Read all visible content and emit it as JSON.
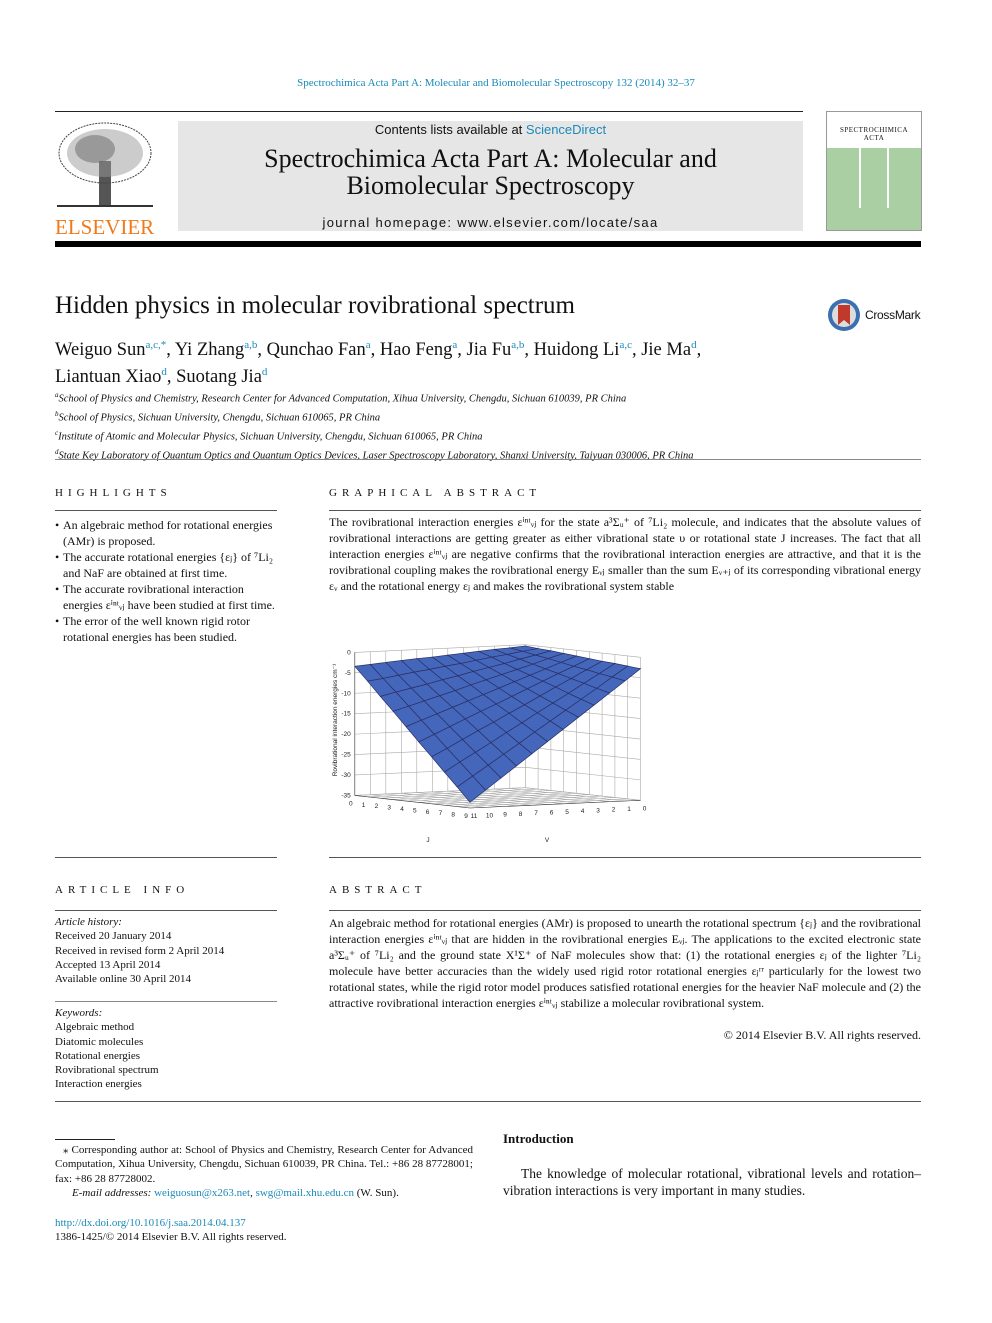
{
  "journal_ref": "Spectrochimica Acta Part A: Molecular and Biomolecular Spectroscopy 132 (2014) 32–37",
  "header": {
    "contents_prefix": "Contents lists available at ",
    "sciencedirect": "ScienceDirect",
    "journal_title_1": "Spectrochimica Acta Part A: Molecular and",
    "journal_title_2": "Biomolecular Spectroscopy",
    "homepage": "journal homepage: www.elsevier.com/locate/saa",
    "publisher_logo": "ELSEVIER",
    "cover_title_1": "SPECTROCHIMICA",
    "cover_title_2": "ACTA"
  },
  "article": {
    "title": "Hidden physics in molecular rovibrational spectrum",
    "crossmark": "CrossMark",
    "authors": [
      {
        "name": "Weiguo Sun",
        "aff": "a,c,*"
      },
      {
        "name": "Yi Zhang",
        "aff": "a,b"
      },
      {
        "name": "Qunchao Fan",
        "aff": "a"
      },
      {
        "name": "Hao Feng",
        "aff": "a"
      },
      {
        "name": "Jia Fu",
        "aff": "a,b"
      },
      {
        "name": "Huidong Li",
        "aff": "a,c"
      },
      {
        "name": "Jie Ma",
        "aff": "d"
      },
      {
        "name": "Liantuan Xiao",
        "aff": "d"
      },
      {
        "name": "Suotang Jia",
        "aff": "d"
      }
    ],
    "affiliations": [
      {
        "key": "a",
        "text": "School of Physics and Chemistry, Research Center for Advanced Computation, Xihua University, Chengdu, Sichuan 610039, PR China"
      },
      {
        "key": "b",
        "text": "School of Physics, Sichuan University, Chengdu, Sichuan 610065, PR China"
      },
      {
        "key": "c",
        "text": "Institute of Atomic and Molecular Physics, Sichuan University, Chengdu, Sichuan 610065, PR China"
      },
      {
        "key": "d",
        "text": "State Key Laboratory of Quantum Optics and Quantum Optics Devices, Laser Spectroscopy Laboratory, Shanxi University, Taiyuan 030006, PR China"
      }
    ]
  },
  "highlights": {
    "heading": "HIGHLIGHTS",
    "items": [
      "An algebraic method for rotational energies (AMr) is proposed.",
      "The accurate rotational energies {εⱼ} of ⁷Li₂ and NaF are obtained at first time.",
      "The accurate rovibrational interaction energies εⁱⁿᵗᵥⱼ have been studied at first time.",
      "The error of the well known rigid rotor rotational energies has been studied."
    ]
  },
  "graphical_abstract": {
    "heading": "GRAPHICAL ABSTRACT",
    "text": "The rovibrational interaction energies εⁱⁿᵗᵥⱼ for the state a³Σᵤ⁺ of ⁷Li₂ molecule, and indicates that the absolute values of rovibrational interactions are getting greater as either vibrational state υ or rotational state J increases. The fact that all interaction energies εⁱⁿᵗᵥⱼ are negative confirms that the rovibrational interaction energies are attractive, and that it is the rovibrational coupling makes the rovibrational energy Eᵥⱼ smaller than the sum Eᵥ₊ⱼ of its corresponding vibrational energy εᵥ and the rotational energy εⱼ and makes the rovibrational system stable"
  },
  "chart_data": {
    "type": "surface",
    "xlabel": "J",
    "ylabel": "V",
    "zlabel": "Rovibrational interaction energies cm⁻¹",
    "x_ticks": [
      0,
      1,
      2,
      3,
      4,
      5,
      6,
      7,
      8,
      9
    ],
    "y_ticks": [
      0,
      1,
      2,
      3,
      4,
      5,
      6,
      7,
      8,
      9,
      10,
      11
    ],
    "z_ticks": [
      0,
      -5,
      -10,
      -15,
      -20,
      -25,
      -30,
      -35
    ],
    "zlim": [
      -35,
      0
    ],
    "grid": true,
    "color": "#4466bb",
    "z_values_by_J_then_V": [
      [
        -0.3,
        -0.6,
        -0.8,
        -1.1,
        -1.4,
        -1.7,
        -2.0,
        -2.2,
        -2.5,
        -2.8,
        -3.1,
        -3.4
      ],
      [
        -0.6,
        -1.1,
        -1.7,
        -2.2,
        -2.8,
        -3.4,
        -3.9,
        -4.5,
        -5.0,
        -5.6,
        -6.2,
        -6.7
      ],
      [
        -0.8,
        -1.7,
        -2.5,
        -3.4,
        -4.2,
        -5.0,
        -5.9,
        -6.7,
        -7.6,
        -8.4,
        -9.2,
        -10.1
      ],
      [
        -1.1,
        -2.2,
        -3.4,
        -4.5,
        -5.6,
        -6.7,
        -7.8,
        -9.0,
        -10.1,
        -11.2,
        -12.3,
        -13.4
      ],
      [
        -1.4,
        -2.8,
        -4.2,
        -5.6,
        -7.0,
        -8.4,
        -9.8,
        -11.2,
        -12.6,
        -14.0,
        -15.4,
        -16.8
      ],
      [
        -1.7,
        -3.4,
        -5.0,
        -6.7,
        -8.4,
        -10.1,
        -11.8,
        -13.4,
        -15.1,
        -16.8,
        -18.5,
        -20.2
      ],
      [
        -2.0,
        -3.9,
        -5.9,
        -7.8,
        -9.8,
        -11.8,
        -13.7,
        -15.7,
        -17.6,
        -19.6,
        -21.6,
        -23.5
      ],
      [
        -2.2,
        -4.5,
        -6.7,
        -9.0,
        -11.2,
        -13.4,
        -15.7,
        -17.9,
        -20.2,
        -22.4,
        -24.6,
        -26.9
      ],
      [
        -2.5,
        -5.0,
        -7.6,
        -10.1,
        -12.6,
        -15.1,
        -17.6,
        -20.2,
        -22.7,
        -25.2,
        -27.7,
        -30.2
      ],
      [
        -2.8,
        -5.6,
        -8.4,
        -11.2,
        -14.0,
        -16.8,
        -19.6,
        -22.4,
        -25.2,
        -28.0,
        -30.8,
        -33.6
      ]
    ]
  },
  "article_info": {
    "heading": "ARTICLE INFO",
    "history_label": "Article history:",
    "history": [
      "Received 20 January 2014",
      "Received in revised form 2 April 2014",
      "Accepted 13 April 2014",
      "Available online 30 April 2014"
    ],
    "keywords_label": "Keywords:",
    "keywords": [
      "Algebraic method",
      "Diatomic molecules",
      "Rotational energies",
      "Rovibrational spectrum",
      "Interaction energies"
    ]
  },
  "abstract": {
    "heading": "ABSTRACT",
    "text": "An algebraic method for rotational energies (AMr) is proposed to unearth the rotational spectrum {εⱼ} and the rovibrational interaction energies εⁱⁿᵗᵥⱼ that are hidden in the rovibrational energies Eᵥⱼ. The applications to the excited electronic state a³Σᵤ⁺ of ⁷Li₂ and the ground state X¹Σ⁺ of NaF molecules show that: (1) the rotational energies εⱼ of the lighter ⁷Li₂ molecule have better accuracies than the widely used rigid rotor rotational energies εⱼʳʳ particularly for the lowest two rotational states, while the rigid rotor model produces satisfied rotational energies for the heavier NaF molecule and (2) the attractive rovibrational interaction energies εⁱⁿᵗᵥⱼ stabilize a molecular rovibrational system.",
    "copyright": "© 2014 Elsevier B.V. All rights reserved."
  },
  "footnote": {
    "corresponding": "⁎ Corresponding author at: School of Physics and Chemistry, Research Center for Advanced Computation, Xihua University, Chengdu, Sichuan 610039, PR China. Tel.: +86 28 87728001; fax: +86 28 87728002.",
    "email_label": "E-mail addresses:",
    "email1": "weiguosun@x263.net",
    "email2": "swg@mail.xhu.edu.cn",
    "email_suffix": " (W. Sun).",
    "doi": "http://dx.doi.org/10.1016/j.saa.2014.04.137",
    "issn": "1386-1425/© 2014 Elsevier B.V. All rights reserved."
  },
  "introduction": {
    "heading": "Introduction",
    "text": "The knowledge of molecular rotational, vibrational levels and rotation–vibration interactions is very important in many studies."
  }
}
